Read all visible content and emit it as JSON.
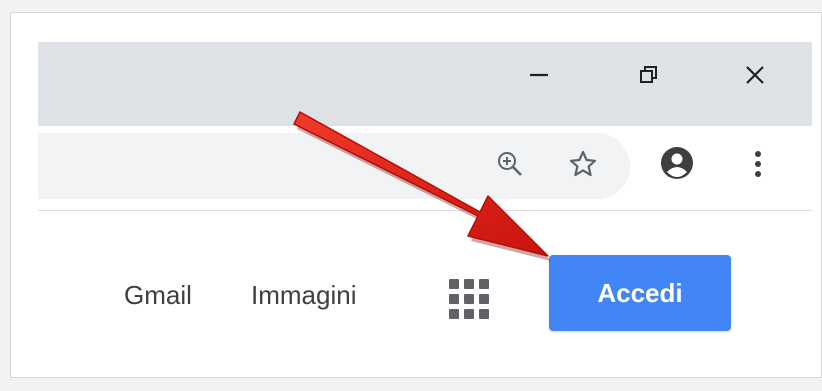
{
  "window_controls": {
    "minimize": "minimize-icon",
    "restore": "restore-icon",
    "close": "close-icon"
  },
  "toolbar": {
    "zoom_icon": "zoom-in-icon",
    "bookmark_icon": "star-icon",
    "profile_icon": "account-circle-icon",
    "menu_icon": "more-vert-icon"
  },
  "header_links": {
    "gmail": "Gmail",
    "images": "Immagini",
    "apps_icon": "apps-grid-icon"
  },
  "signin": {
    "label": "Accedi",
    "color": "#4285f4"
  },
  "annotation": {
    "arrow_color": "#e8201a"
  }
}
